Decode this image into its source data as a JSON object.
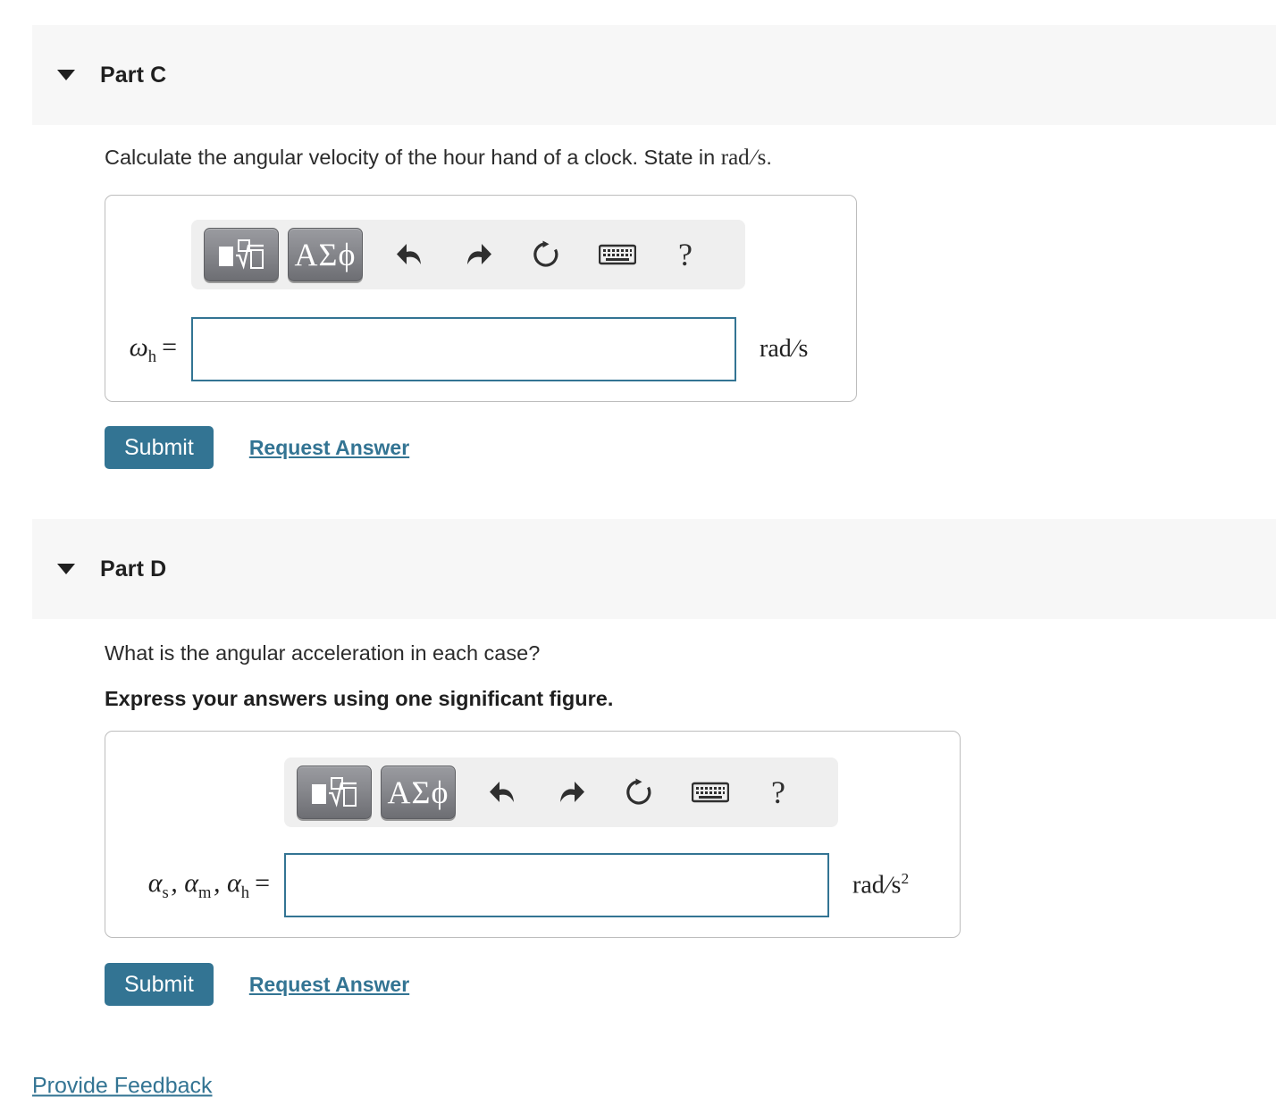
{
  "parts": [
    {
      "id": "c",
      "title": "Part C",
      "caret_icon": "caret-down-icon",
      "prompt_text": "Calculate the angular velocity of the hour hand of a clock. State in ",
      "prompt_unit": "rad/s",
      "prompt_end": ".",
      "bold_instruction": "",
      "toolbar": {
        "template_button": "math-template-button",
        "greek_button_label": "ΑΣϕ",
        "undo_icon": "undo-icon",
        "redo_icon": "redo-icon",
        "reset_icon": "reset-icon",
        "keyboard_icon": "keyboard-icon",
        "help_label": "?"
      },
      "answer": {
        "variable": "ω",
        "subscript": "h",
        "equals": "=",
        "value": "",
        "placeholder": "",
        "unit": "rad/s",
        "unit_exponent": ""
      },
      "submit_label": "Submit",
      "request_answer_label": "Request Answer"
    },
    {
      "id": "d",
      "title": "Part D",
      "caret_icon": "caret-down-icon",
      "prompt_text": "What is the angular acceleration in each case?",
      "prompt_unit": "",
      "prompt_end": "",
      "bold_instruction": "Express your answers using one significant figure.",
      "toolbar": {
        "template_button": "math-template-button",
        "greek_button_label": "ΑΣϕ",
        "undo_icon": "undo-icon",
        "redo_icon": "redo-icon",
        "reset_icon": "reset-icon",
        "keyboard_icon": "keyboard-icon",
        "help_label": "?"
      },
      "answer": {
        "variables": "αs , αm , αh",
        "equals": "=",
        "value": "",
        "placeholder": "",
        "unit": "rad/s",
        "unit_exponent": "2"
      },
      "submit_label": "Submit",
      "request_answer_label": "Request Answer"
    }
  ],
  "footer": {
    "feedback_label": "Provide Feedback"
  },
  "colors": {
    "accent": "#337493",
    "header_band": "#f7f7f7",
    "toolbar_bg": "#efefef",
    "container_border": "#bdbdbd"
  }
}
